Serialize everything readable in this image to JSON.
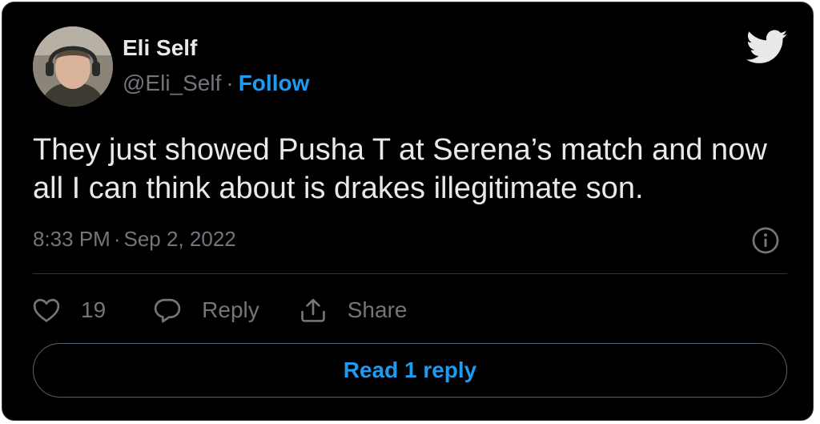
{
  "user": {
    "display_name": "Eli Self",
    "handle": "@Eli_Self",
    "separator": "·",
    "follow_label": "Follow"
  },
  "tweet": {
    "text": "They just showed Pusha T at Serena’s match and now all I can think about is drakes illegitimate son.",
    "time": "8:33 PM",
    "separator": "·",
    "date": "Sep 2, 2022"
  },
  "actions": {
    "like_count": "19",
    "reply_label": "Reply",
    "share_label": "Share"
  },
  "read_replies_label": "Read 1 reply",
  "icons": {
    "logo": "twitter-bird-icon",
    "info": "info-icon",
    "like": "heart-icon",
    "reply": "reply-bubble-icon",
    "share": "share-icon"
  },
  "colors": {
    "background": "#000000",
    "text": "#e7e9ea",
    "secondary_text": "#71767b",
    "accent": "#1d9bf0"
  }
}
